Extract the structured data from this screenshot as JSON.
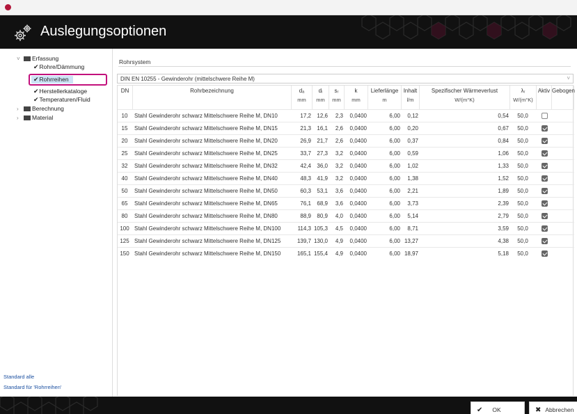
{
  "window": {
    "app_icon": "app-dot-icon"
  },
  "header": {
    "title": "Auslegungsoptionen",
    "icon": "gears-icon"
  },
  "sidebar": {
    "items": [
      {
        "label": "Erfassung",
        "expanded": true,
        "kind": "folder-open"
      },
      {
        "label": "Rohre/Dämmung",
        "kind": "check"
      },
      {
        "label": "Rohrreihen",
        "kind": "check",
        "selected": true
      },
      {
        "label": "Herstellerkataloge",
        "kind": "check"
      },
      {
        "label": "Temperaturen/Fluid",
        "kind": "check"
      },
      {
        "label": "Berechnung",
        "kind": "folder"
      },
      {
        "label": "Material",
        "kind": "folder"
      }
    ],
    "link_standard_all": "Standard alle",
    "link_standard_section": "Standard für 'Rohrreihen'"
  },
  "main": {
    "section_label": "Rohrsystem",
    "system_select": "DIN EN 10255 - Gewinderohr (mittelschwere Reihe M)",
    "columns": [
      {
        "key": "dn",
        "label": "DN",
        "unit": ""
      },
      {
        "key": "name",
        "label": "Rohrbezeichnung",
        "unit": ""
      },
      {
        "key": "da",
        "label": "dₐ",
        "unit": "mm"
      },
      {
        "key": "di",
        "label": "dᵢ",
        "unit": "mm"
      },
      {
        "key": "sr",
        "label": "sᵣ",
        "unit": "mm"
      },
      {
        "key": "k",
        "label": "k",
        "unit": "mm"
      },
      {
        "key": "len",
        "label": "Lieferlänge",
        "unit": "m"
      },
      {
        "key": "inh",
        "label": "Inhalt",
        "unit": "l/m"
      },
      {
        "key": "wv",
        "label": "Spezifischer Wärmeverlust",
        "unit": "W/(m°K)"
      },
      {
        "key": "lam",
        "label": "λᵣ",
        "unit": "W/(m°K)"
      },
      {
        "key": "aktiv",
        "label": "Aktiv",
        "unit": ""
      },
      {
        "key": "geb",
        "label": "Gebogen",
        "unit": ""
      }
    ],
    "rows": [
      {
        "dn": "10",
        "name": "Stahl Gewinderohr schwarz Mittelschwere Reihe M, DN10",
        "da": "17,2",
        "di": "12,6",
        "sr": "2,3",
        "k": "0,0400",
        "len": "6,00",
        "inh": "0,12",
        "wv": "0,54",
        "lam": "50,0",
        "aktiv": false
      },
      {
        "dn": "15",
        "name": "Stahl Gewinderohr schwarz Mittelschwere Reihe M, DN15",
        "da": "21,3",
        "di": "16,1",
        "sr": "2,6",
        "k": "0,0400",
        "len": "6,00",
        "inh": "0,20",
        "wv": "0,67",
        "lam": "50,0",
        "aktiv": true
      },
      {
        "dn": "20",
        "name": "Stahl Gewinderohr schwarz Mittelschwere Reihe M, DN20",
        "da": "26,9",
        "di": "21,7",
        "sr": "2,6",
        "k": "0,0400",
        "len": "6,00",
        "inh": "0,37",
        "wv": "0,84",
        "lam": "50,0",
        "aktiv": true
      },
      {
        "dn": "25",
        "name": "Stahl Gewinderohr schwarz Mittelschwere Reihe M, DN25",
        "da": "33,7",
        "di": "27,3",
        "sr": "3,2",
        "k": "0,0400",
        "len": "6,00",
        "inh": "0,59",
        "wv": "1,06",
        "lam": "50,0",
        "aktiv": true
      },
      {
        "dn": "32",
        "name": "Stahl Gewinderohr schwarz Mittelschwere Reihe M, DN32",
        "da": "42,4",
        "di": "36,0",
        "sr": "3,2",
        "k": "0,0400",
        "len": "6,00",
        "inh": "1,02",
        "wv": "1,33",
        "lam": "50,0",
        "aktiv": true
      },
      {
        "dn": "40",
        "name": "Stahl Gewinderohr schwarz Mittelschwere Reihe M, DN40",
        "da": "48,3",
        "di": "41,9",
        "sr": "3,2",
        "k": "0,0400",
        "len": "6,00",
        "inh": "1,38",
        "wv": "1,52",
        "lam": "50,0",
        "aktiv": true
      },
      {
        "dn": "50",
        "name": "Stahl Gewinderohr schwarz Mittelschwere Reihe M, DN50",
        "da": "60,3",
        "di": "53,1",
        "sr": "3,6",
        "k": "0,0400",
        "len": "6,00",
        "inh": "2,21",
        "wv": "1,89",
        "lam": "50,0",
        "aktiv": true
      },
      {
        "dn": "65",
        "name": "Stahl Gewinderohr schwarz Mittelschwere Reihe M, DN65",
        "da": "76,1",
        "di": "68,9",
        "sr": "3,6",
        "k": "0,0400",
        "len": "6,00",
        "inh": "3,73",
        "wv": "2,39",
        "lam": "50,0",
        "aktiv": true
      },
      {
        "dn": "80",
        "name": "Stahl Gewinderohr schwarz Mittelschwere Reihe M, DN80",
        "da": "88,9",
        "di": "80,9",
        "sr": "4,0",
        "k": "0,0400",
        "len": "6,00",
        "inh": "5,14",
        "wv": "2,79",
        "lam": "50,0",
        "aktiv": true
      },
      {
        "dn": "100",
        "name": "Stahl Gewinderohr schwarz Mittelschwere Reihe M, DN100",
        "da": "114,3",
        "di": "105,3",
        "sr": "4,5",
        "k": "0,0400",
        "len": "6,00",
        "inh": "8,71",
        "wv": "3,59",
        "lam": "50,0",
        "aktiv": true
      },
      {
        "dn": "125",
        "name": "Stahl Gewinderohr schwarz Mittelschwere Reihe M, DN125",
        "da": "139,7",
        "di": "130,0",
        "sr": "4,9",
        "k": "0,0400",
        "len": "6,00",
        "inh": "13,27",
        "wv": "4,38",
        "lam": "50,0",
        "aktiv": true
      },
      {
        "dn": "150",
        "name": "Stahl Gewinderohr schwarz Mittelschwere Reihe M, DN150",
        "da": "165,1",
        "di": "155,4",
        "sr": "4,9",
        "k": "0,0400",
        "len": "6,00",
        "inh": "18,97",
        "wv": "5,18",
        "lam": "50,0",
        "aktiv": true
      }
    ]
  },
  "footer": {
    "ok_label": "OK",
    "cancel_label": "Abbrechen"
  },
  "colors": {
    "accent": "#c2107c",
    "header_bg": "#111111",
    "selection": "#cde3f6",
    "link": "#1a4fa0"
  }
}
